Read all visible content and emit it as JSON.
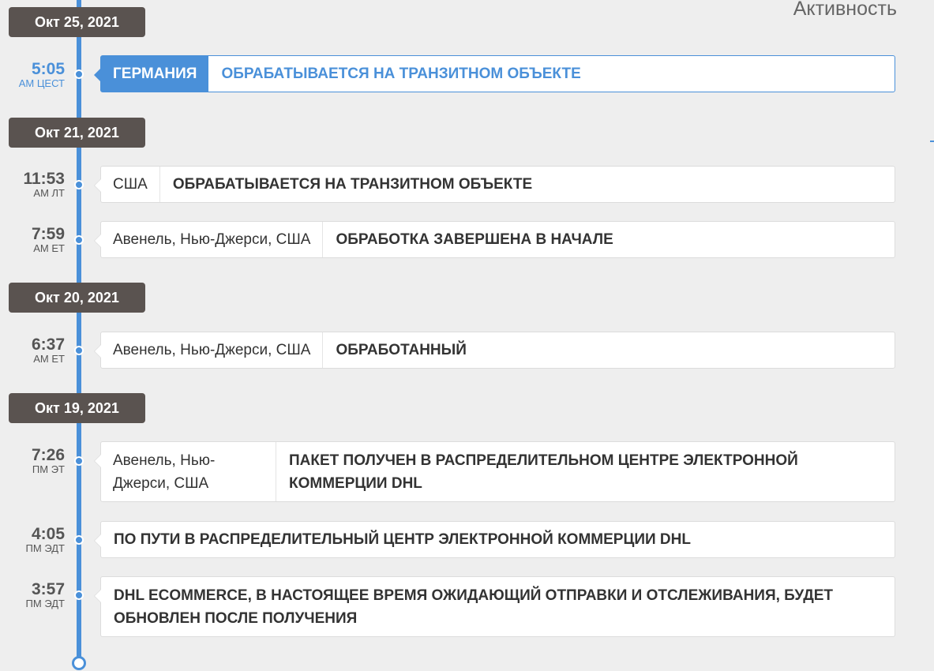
{
  "heading": "Активность",
  "dates": [
    "Окт 25, 2021",
    "Окт 21, 2021",
    "Окт 20, 2021",
    "Окт 19, 2021"
  ],
  "events": [
    {
      "time": "5:05",
      "zone": "AM ЦЕСТ",
      "location": "ГЕРМАНИЯ",
      "status": "ОБРАБАТЫВАЕТСЯ НА ТРАНЗИТНОМ ОБЪЕКТЕ"
    },
    {
      "time": "11:53",
      "zone": "AM ЛТ",
      "location": "США",
      "status": "ОБРАБАТЫВАЕТСЯ НА ТРАНЗИТНОМ ОБЪЕКТЕ"
    },
    {
      "time": "7:59",
      "zone": "AM ET",
      "location": "Авенель, Нью-Джерси, США",
      "status": "ОБРАБОТКА ЗАВЕРШЕНА В НАЧАЛЕ"
    },
    {
      "time": "6:37",
      "zone": "AM ET",
      "location": "Авенель, Нью-Джерси, США",
      "status": "ОБРАБОТАННЫЙ"
    },
    {
      "time": "7:26",
      "zone": "ПМ ЭТ",
      "location": "Авенель, Нью-Джерси, США",
      "status": "ПАКЕТ ПОЛУЧЕН В РАСПРЕДЕЛИТЕЛЬНОМ ЦЕНТРЕ ЭЛЕКТРОННОЙ КОММЕРЦИИ DHL"
    },
    {
      "time": "4:05",
      "zone": "ПМ ЭДТ",
      "status": "ПО ПУТИ В РАСПРЕДЕЛИТЕЛЬНЫЙ ЦЕНТР ЭЛЕКТРОННОЙ КОММЕРЦИИ DHL"
    },
    {
      "time": "3:57",
      "zone": "ПМ ЭДТ",
      "status": "DHL ECOMMERCE, В НАСТОЯЩЕЕ ВРЕМЯ ОЖИДАЮЩИЙ ОТПРАВКИ И ОТСЛЕЖИВАНИЯ, БУДЕТ ОБНОВЛЕН ПОСЛЕ ПОЛУЧЕНИЯ"
    }
  ],
  "colors": {
    "accent": "#4a90d9",
    "date_badge": "#5a5350",
    "background": "#eeeeee"
  }
}
